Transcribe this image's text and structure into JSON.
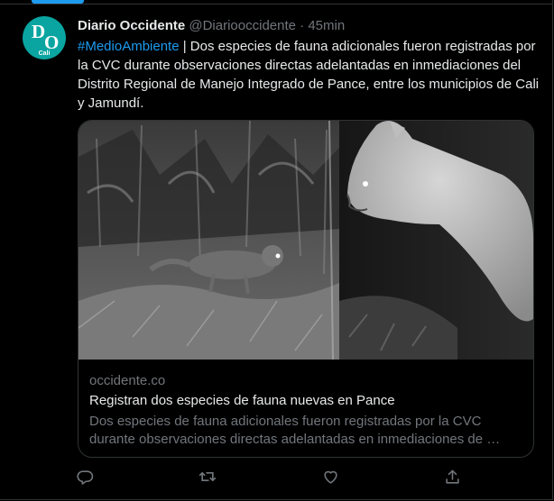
{
  "tweet": {
    "author_name": "Diario Occidente",
    "author_handle": "@Diariooccidente",
    "separator": "·",
    "time": "45min",
    "avatar": {
      "letter_1": "D",
      "letter_2": "O",
      "city": "Cali"
    },
    "hashtag": "#MedioAmbiente",
    "text": " | Dos especies de fauna adicionales fueron registradas por la CVC durante observaciones directas adelantadas en inmediaciones del Distrito Regional de Manejo Integrado de Pance, entre los municipios de Cali y Jamundí."
  },
  "card": {
    "domain": "occidente.co",
    "title": "Registran dos especies de fauna nuevas en Pance",
    "description": "Dos especies de fauna adicionales fueron registradas por la CVC durante observaciones directas adelantadas en inmediaciones de …"
  },
  "actions": [
    {
      "icon": "reply-icon"
    },
    {
      "icon": "retweet-icon"
    },
    {
      "icon": "like-icon"
    },
    {
      "icon": "share-icon"
    }
  ],
  "colors": {
    "background": "#000000",
    "accent": "#1d9bf0",
    "text": "#e7e9ea",
    "muted": "#71767b",
    "border": "#2f3336"
  }
}
